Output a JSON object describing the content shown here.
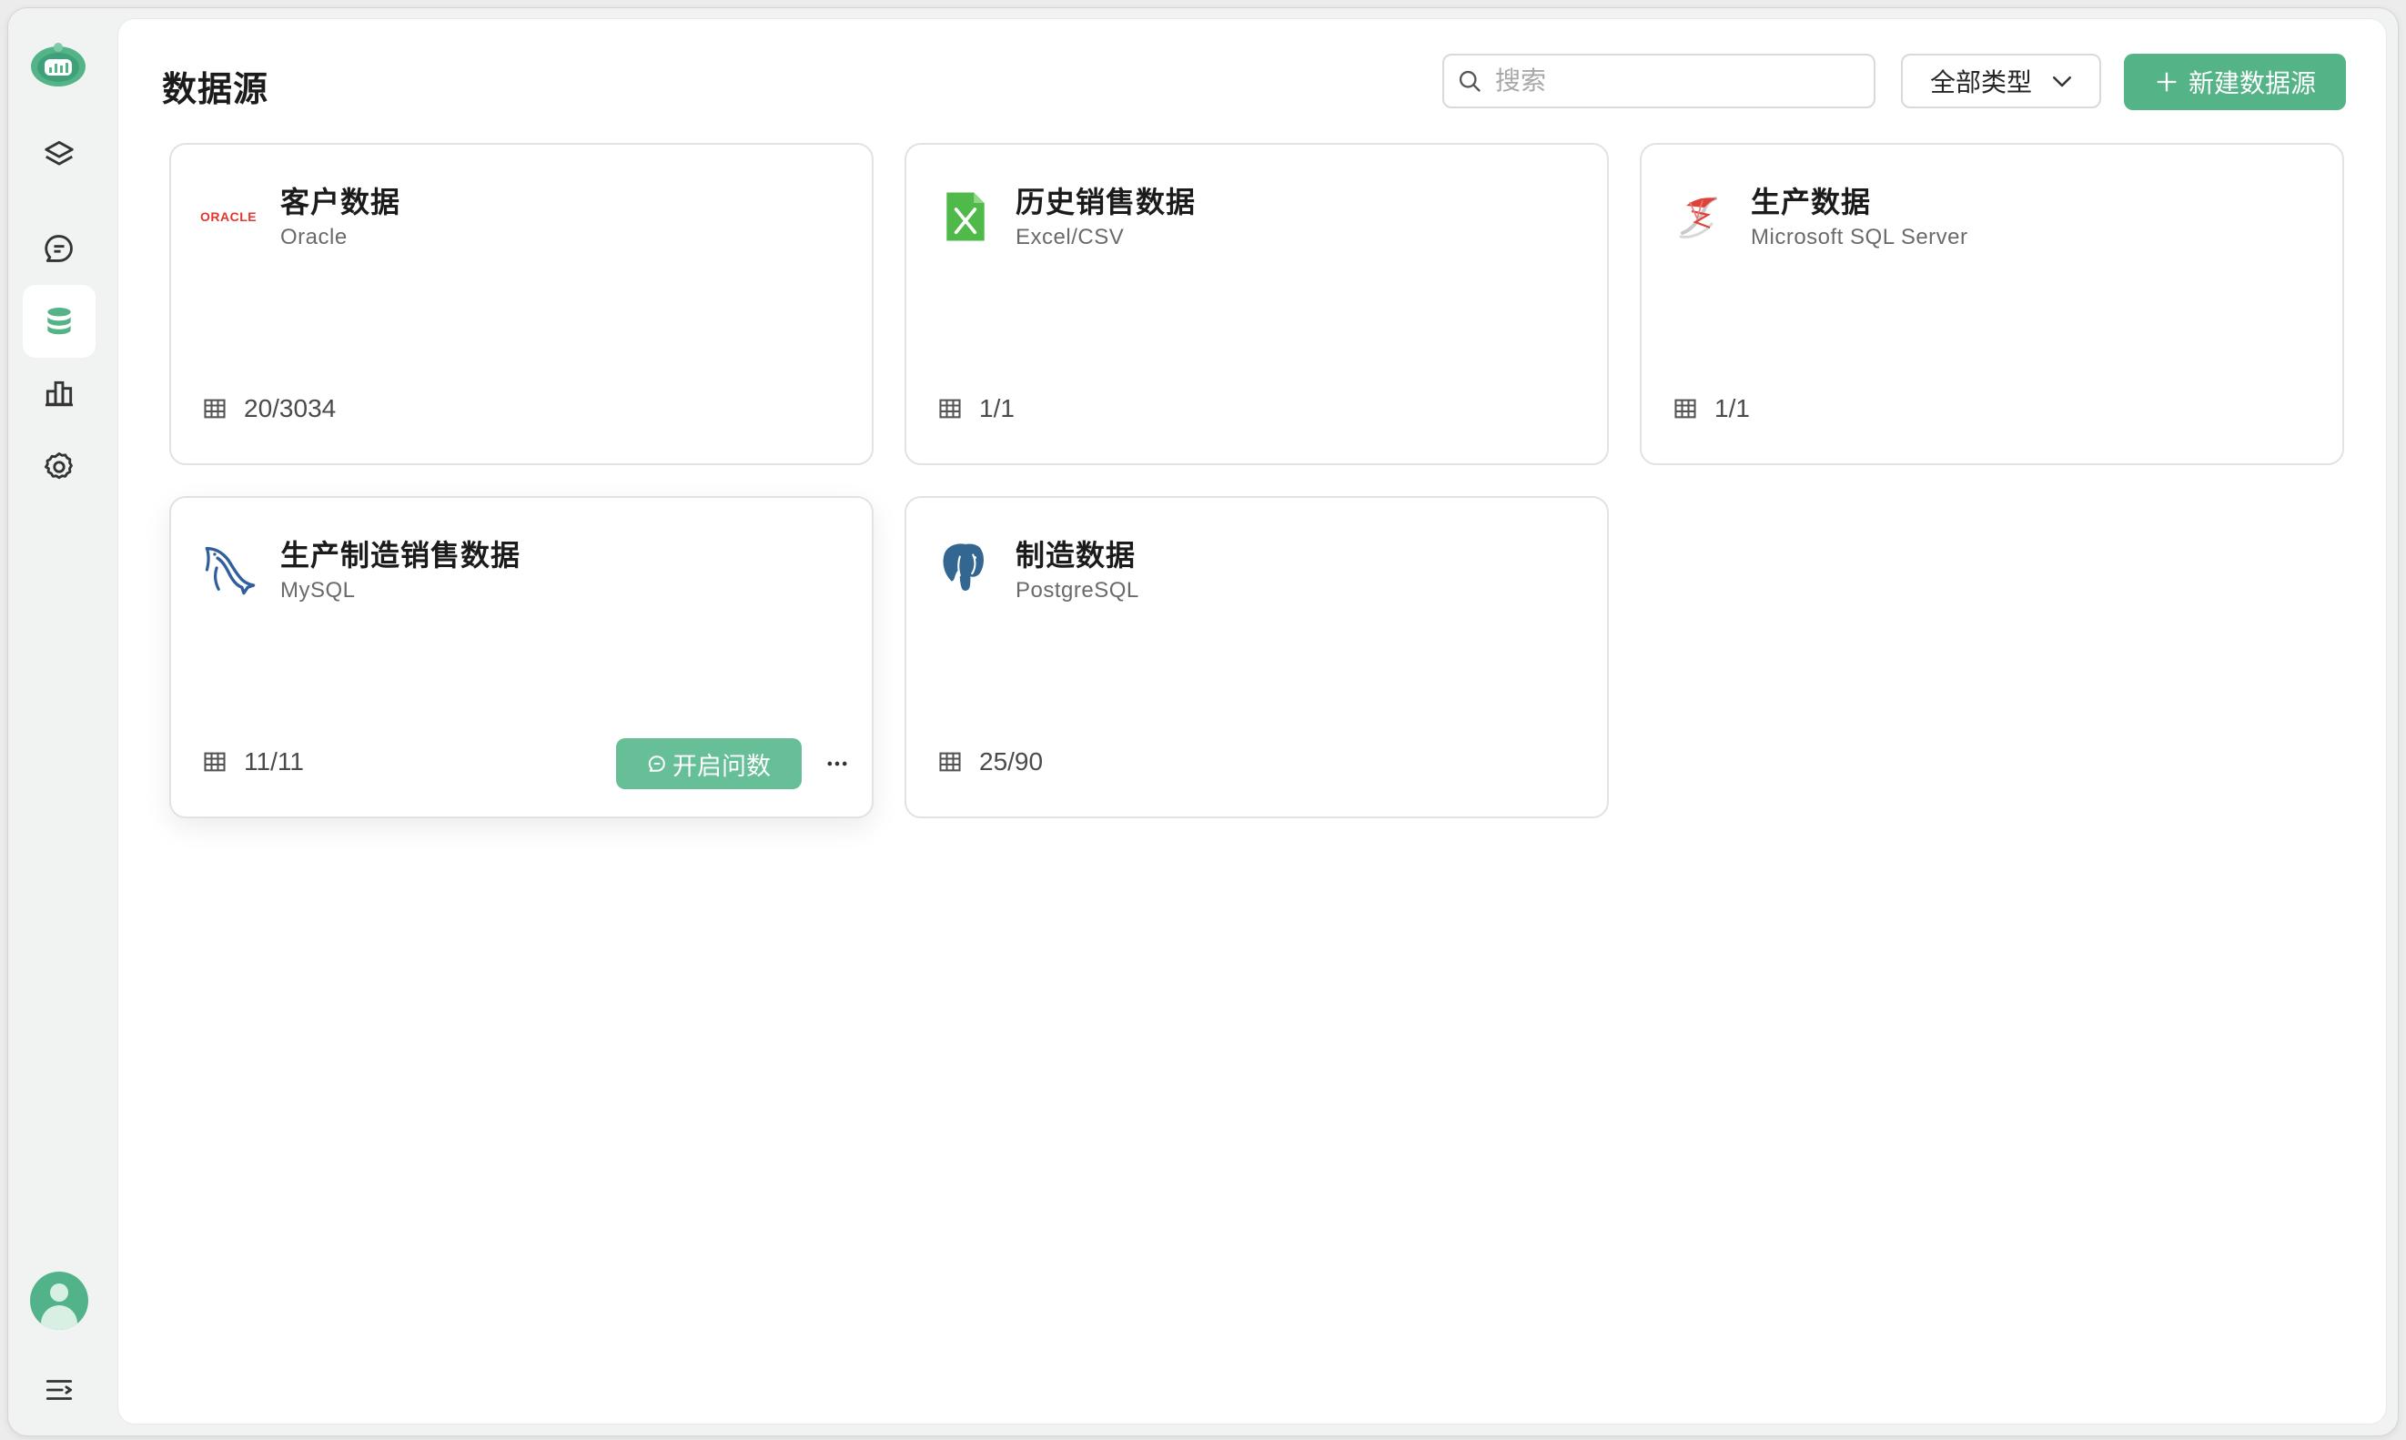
{
  "page": {
    "title": "数据源"
  },
  "toolbar": {
    "search_placeholder": "搜索",
    "type_filter": "全部类型",
    "new_button": "新建数据源"
  },
  "sidebar": {
    "items": [
      {
        "name": "layers",
        "icon": "layers-icon",
        "active": false
      },
      {
        "name": "chat",
        "icon": "chat-icon",
        "active": false
      },
      {
        "name": "datasource",
        "icon": "database-icon",
        "active": true
      },
      {
        "name": "charts",
        "icon": "bar-chart-icon",
        "active": false
      },
      {
        "name": "settings",
        "icon": "gear-icon",
        "active": false
      }
    ]
  },
  "cards": [
    {
      "name": "客户数据",
      "type": "Oracle",
      "logo_text": "ORACLE",
      "icon": "oracle-logo",
      "tables": "20/3034"
    },
    {
      "name": "历史销售数据",
      "type": "Excel/CSV",
      "icon": "excel-icon",
      "tables": "1/1"
    },
    {
      "name": "生产数据",
      "type": "Microsoft SQL Server",
      "icon": "sql-server-icon",
      "tables": "1/1"
    },
    {
      "name": "生产制造销售数据",
      "type": "MySQL",
      "icon": "mysql-dolphin-icon",
      "tables": "11/11",
      "ask_button": "开启问数"
    },
    {
      "name": "制造数据",
      "type": "PostgreSQL",
      "icon": "postgresql-elephant-icon",
      "tables": "25/90"
    }
  ],
  "colors": {
    "accent": "#55b487",
    "accent_light": "#67bf98"
  }
}
